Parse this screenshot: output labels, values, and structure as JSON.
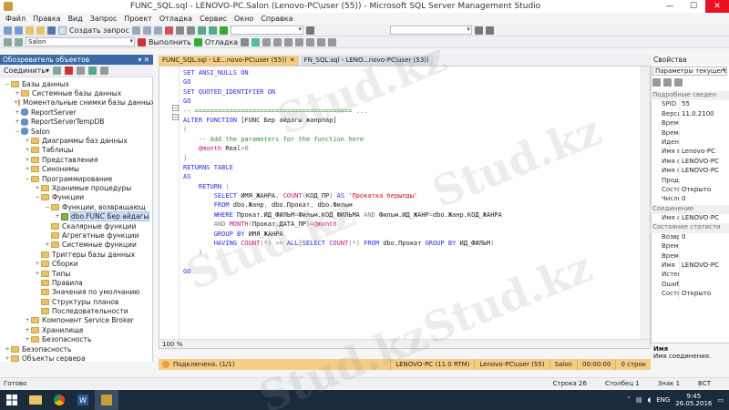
{
  "window": {
    "title": "FUNC_SQL.sql - LENOVO-PC.Salon (Lenovo-PC\\user (55)) - Microsoft SQL Server Management Studio",
    "minimize": "—",
    "maximize": "☐",
    "close": "✕"
  },
  "menu": [
    "Файл",
    "Правка",
    "Вид",
    "Запрос",
    "Проект",
    "Отладка",
    "Сервис",
    "Окно",
    "Справка"
  ],
  "toolbar": {
    "new_query": "Создать запрос",
    "database": "Salon",
    "execute": "Выполнить",
    "debug": "Отладка"
  },
  "object_explorer": {
    "title": "Обозреватель объектов",
    "pin": "▾ ✕",
    "connect": "Соединить▾",
    "tree": [
      {
        "depth": 0,
        "exp": "−",
        "icon": "folder",
        "label": "Базы данных"
      },
      {
        "depth": 1,
        "exp": "+",
        "icon": "folder",
        "label": "Системные базы данных"
      },
      {
        "depth": 1,
        "exp": "+",
        "icon": "folder",
        "label": "Моментальные снимки базы данных"
      },
      {
        "depth": 1,
        "exp": "+",
        "icon": "db",
        "label": "ReportServer"
      },
      {
        "depth": 1,
        "exp": "+",
        "icon": "db",
        "label": "ReportServerTempDB"
      },
      {
        "depth": 1,
        "exp": "−",
        "icon": "db",
        "label": "Salon"
      },
      {
        "depth": 2,
        "exp": "+",
        "icon": "folder",
        "label": "Диаграммы баз данных"
      },
      {
        "depth": 2,
        "exp": "+",
        "icon": "folder",
        "label": "Таблицы"
      },
      {
        "depth": 2,
        "exp": "+",
        "icon": "folder",
        "label": "Представления"
      },
      {
        "depth": 2,
        "exp": "+",
        "icon": "folder",
        "label": "Синонимы"
      },
      {
        "depth": 2,
        "exp": "−",
        "icon": "folder",
        "label": "Программирование"
      },
      {
        "depth": 3,
        "exp": "+",
        "icon": "folder",
        "label": "Хранимые процедуры"
      },
      {
        "depth": 3,
        "exp": "−",
        "icon": "folder",
        "label": "Функции"
      },
      {
        "depth": 4,
        "exp": "−",
        "icon": "folder",
        "label": "Функции, возвращающ"
      },
      {
        "depth": 5,
        "exp": "+",
        "icon": "fn",
        "label": "dbo.FUNC Бер айдагы",
        "selected": true
      },
      {
        "depth": 4,
        "exp": "",
        "icon": "folder",
        "label": "Скалярные функции"
      },
      {
        "depth": 4,
        "exp": "",
        "icon": "folder",
        "label": "Агрегатные функции"
      },
      {
        "depth": 4,
        "exp": "+",
        "icon": "folder",
        "label": "Системные функции"
      },
      {
        "depth": 3,
        "exp": "",
        "icon": "folder",
        "label": "Триггеры базы данных"
      },
      {
        "depth": 3,
        "exp": "+",
        "icon": "folder",
        "label": "Сборки"
      },
      {
        "depth": 3,
        "exp": "+",
        "icon": "folder",
        "label": "Типы"
      },
      {
        "depth": 3,
        "exp": "",
        "icon": "folder",
        "label": "Правила"
      },
      {
        "depth": 3,
        "exp": "",
        "icon": "folder",
        "label": "Значения по умолчанию"
      },
      {
        "depth": 3,
        "exp": "",
        "icon": "folder",
        "label": "Структуры планов"
      },
      {
        "depth": 3,
        "exp": "",
        "icon": "folder",
        "label": "Последовательности"
      },
      {
        "depth": 2,
        "exp": "+",
        "icon": "folder",
        "label": "Компонент Service Broker"
      },
      {
        "depth": 2,
        "exp": "+",
        "icon": "folder",
        "label": "Хранилище"
      },
      {
        "depth": 2,
        "exp": "+",
        "icon": "folder",
        "label": "Безопасность"
      },
      {
        "depth": 0,
        "exp": "+",
        "icon": "folder",
        "label": "Безопасность"
      },
      {
        "depth": 0,
        "exp": "+",
        "icon": "folder",
        "label": "Объекты сервера"
      }
    ]
  },
  "tabs": [
    {
      "label": "FUNC_SQL.sql - LE...novo-PC\\user (55))",
      "close": "✕",
      "active": true
    },
    {
      "label": "FN_SQL.sql - LENO...novo-PC\\user (53))",
      "close": "",
      "active": false
    }
  ],
  "code_lines": [
    [
      [
        "kw",
        "SET ANSI_NULLS ON"
      ]
    ],
    [
      [
        "kw",
        "GO"
      ]
    ],
    [
      [
        "kw",
        "SET QUOTED_IDENTIFIER ON"
      ]
    ],
    [
      [
        "kw",
        "GO"
      ]
    ],
    [
      [
        "cm",
        "-- ========================================="
      ],
      [
        "gr",
        " ..."
      ]
    ],
    [
      [
        "kw",
        "ALTER FUNCTION "
      ],
      [
        "tx",
        "[FUNC Бер айдагы жанрлар]"
      ]
    ],
    [
      [
        "gr",
        "("
      ]
    ],
    [
      [
        "cm",
        "    -- Add the parameters for the function here"
      ]
    ],
    [
      [
        "tx",
        "    "
      ],
      [
        "fn",
        "@month "
      ],
      [
        "tx",
        "Real"
      ],
      [
        "gr",
        "=0"
      ]
    ],
    [
      [
        "gr",
        ")"
      ]
    ],
    [
      [
        "kw",
        "RETURNS TABLE"
      ]
    ],
    [
      [
        "kw",
        "AS"
      ]
    ],
    [
      [
        "kw",
        "    RETURN "
      ],
      [
        "gr",
        "("
      ]
    ],
    [
      [
        "kw",
        "        SELECT "
      ],
      [
        "tx",
        "ИМЯ_ЖАНРА"
      ],
      [
        "gr",
        ", "
      ],
      [
        "fn",
        "COUNT"
      ],
      [
        "gr",
        "("
      ],
      [
        "tx",
        "КОД_ПР"
      ],
      [
        "gr",
        ") "
      ],
      [
        "kw",
        "AS "
      ],
      [
        "str",
        "'Прокатка берылды'"
      ]
    ],
    [
      [
        "kw",
        "        FROM "
      ],
      [
        "tx",
        "dbo.Жанр"
      ],
      [
        "gr",
        ", "
      ],
      [
        "tx",
        "dbo.Прокат"
      ],
      [
        "gr",
        ", "
      ],
      [
        "tx",
        "dbo.Фильм"
      ]
    ],
    [
      [
        "kw",
        "        WHERE "
      ],
      [
        "tx",
        "Прокат.ИД_ФИЛЬМ"
      ],
      [
        "gr",
        "="
      ],
      [
        "tx",
        "Фильм.КОД_ФИЛЬМА "
      ],
      [
        "gr",
        "AND "
      ],
      [
        "tx",
        "Фильм.ИД_ЖАНР"
      ],
      [
        "gr",
        "="
      ],
      [
        "tx",
        "dbo.Жанр.КОД_ЖАНРА"
      ]
    ],
    [
      [
        "gr",
        "        AND "
      ],
      [
        "fn",
        "MONTH"
      ],
      [
        "gr",
        "("
      ],
      [
        "tx",
        "Прокат.ДАТА_ПР"
      ],
      [
        "gr",
        ")="
      ],
      [
        "fn",
        "@month"
      ]
    ],
    [
      [
        "kw",
        "        GROUP BY "
      ],
      [
        "tx",
        "ИМЯ_ЖАНРА"
      ]
    ],
    [
      [
        "kw",
        "        HAVING "
      ],
      [
        "fn",
        "COUNT"
      ],
      [
        "gr",
        "(*) >= "
      ],
      [
        "kw",
        "ALL"
      ],
      [
        "gr",
        "("
      ],
      [
        "kw",
        "SELECT "
      ],
      [
        "fn",
        "COUNT"
      ],
      [
        "gr",
        "(*) "
      ],
      [
        "kw",
        "FROM "
      ],
      [
        "tx",
        "dbo.Прокат "
      ],
      [
        "kw",
        "GROUP BY "
      ],
      [
        "tx",
        "ИД_ФИЛЬМ"
      ],
      [
        "gr",
        ")"
      ]
    ],
    [
      [
        "gr",
        "    )"
      ]
    ],
    [
      [
        "tx",
        ""
      ]
    ],
    [
      [
        "kw",
        "GO"
      ]
    ]
  ],
  "editor": {
    "zoom": "100 %"
  },
  "query_status": {
    "connected": "Подключена. (1/1)",
    "server": "LENOVO-PC (11.0 RTM)",
    "user": "Lenovo-PC\\user (55)",
    "db": "Salon",
    "time": "00:00:00",
    "rows": "0 строк"
  },
  "properties": {
    "title": "Свойства",
    "selector": "Параметры текущего",
    "cats": {
      "details": "Подробные сведен",
      "connection": "Соединение",
      "stats": "Состояние статисти"
    },
    "rows_details": [
      {
        "k": "SPID",
        "v": "55"
      },
      {
        "k": "Версия",
        "v": "11.0.2100"
      },
      {
        "k": "Время",
        "v": ""
      },
      {
        "k": "Время",
        "v": ""
      },
      {
        "k": "Иденти",
        "v": ""
      },
      {
        "k": "Имя вх",
        "v": "Lenovo-PC"
      },
      {
        "k": "Имя се",
        "v": "LENOVO-PC"
      },
      {
        "k": "Имя се",
        "v": "LENOVO-PC"
      },
      {
        "k": "Продол",
        "v": ""
      },
      {
        "k": "Состоя",
        "v": "Открыто"
      },
      {
        "k": "Число",
        "v": "0"
      }
    ],
    "rows_conn": [
      {
        "k": "Имя со",
        "v": "LENOVO-PC"
      }
    ],
    "rows_stats": [
      {
        "k": "Возвра",
        "v": "0"
      },
      {
        "k": "Время",
        "v": ""
      },
      {
        "k": "Время",
        "v": ""
      },
      {
        "k": "Имя",
        "v": "LENOVO-PC"
      },
      {
        "k": "Истекш",
        "v": ""
      },
      {
        "k": "Ошибк",
        "v": ""
      },
      {
        "k": "Состоя",
        "v": "Открыто"
      }
    ],
    "desc_title": "Имя",
    "desc_text": "Имя соединения."
  },
  "statusbar": {
    "ready": "Готово",
    "row": "Строка 26",
    "col": "Столбец 1",
    "char": "Знак 1",
    "mode": "ВСТ"
  },
  "taskbar": {
    "lang": "ENG",
    "time": "9:45",
    "date": "26.05.2016"
  },
  "watermark": "Stud.kz",
  "colors": {
    "panel_head": "#3c6aa6",
    "active_tab": "#f5cc84",
    "keyword": "#2a2aff",
    "comment": "#2f8f3f",
    "string": "#d01212",
    "taskbar": "#1a2b3c"
  }
}
